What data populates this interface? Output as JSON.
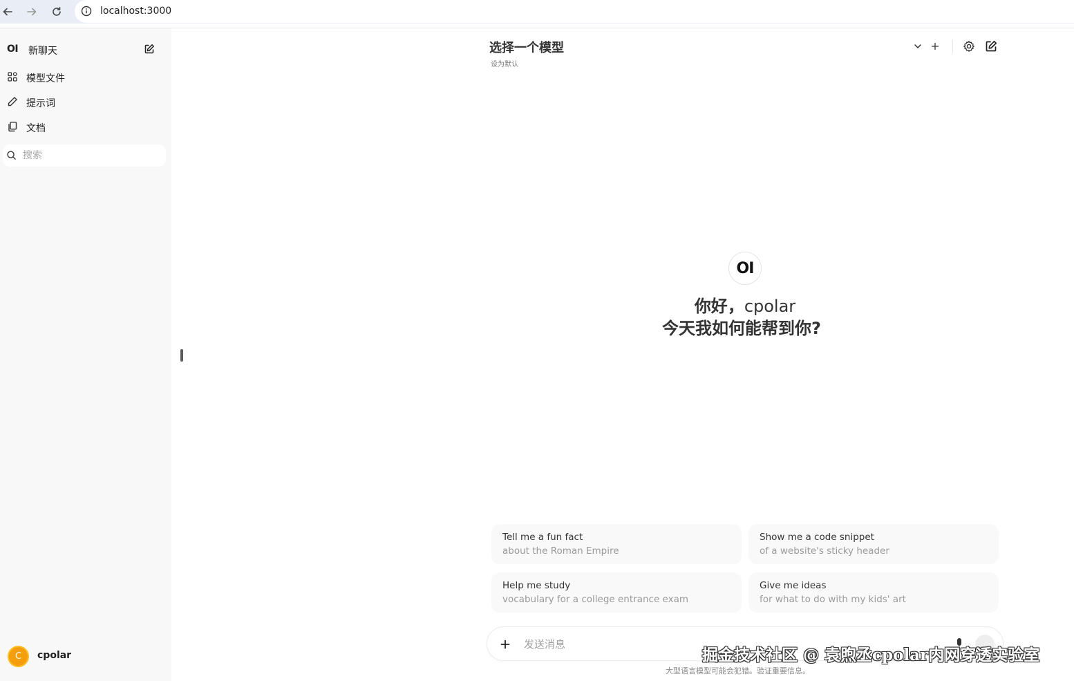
{
  "browser": {
    "url": "localhost:3000"
  },
  "sidebar": {
    "logo": "OI",
    "new_chat": "新聊天",
    "items": [
      {
        "label": "模型文件",
        "icon": "grid-icon"
      },
      {
        "label": "提示词",
        "icon": "pencil-icon"
      },
      {
        "label": "文档",
        "icon": "documents-icon"
      }
    ],
    "search_placeholder": "搜索",
    "user": {
      "initial": "C",
      "name": "cpolar"
    }
  },
  "header": {
    "model_select": "选择一个模型",
    "set_default": "设为默认"
  },
  "main": {
    "logo": "OI",
    "greeting_prefix": "你好，",
    "greeting_name": "cpolar",
    "greeting_line2": "今天我如何能帮到你?",
    "suggestions": [
      {
        "title": "Tell me a fun fact",
        "subtitle": "about the Roman Empire"
      },
      {
        "title": "Show me a code snippet",
        "subtitle": "of a website's sticky header"
      },
      {
        "title": "Help me study",
        "subtitle": "vocabulary for a college entrance exam"
      },
      {
        "title": "Give me ideas",
        "subtitle": "for what to do with my kids' art"
      }
    ],
    "input_placeholder": "发送消息",
    "disclaimer": "大型语言模型可能会犯错。验证重要信息。"
  },
  "watermark": "掘金技术社区 @ 袁煦丞cpolar内网穿透实验室",
  "colors": {
    "avatar": "#f59e0b",
    "sidebar_bg": "#f8f8f8",
    "chrome_bg": "#e9eef6"
  }
}
